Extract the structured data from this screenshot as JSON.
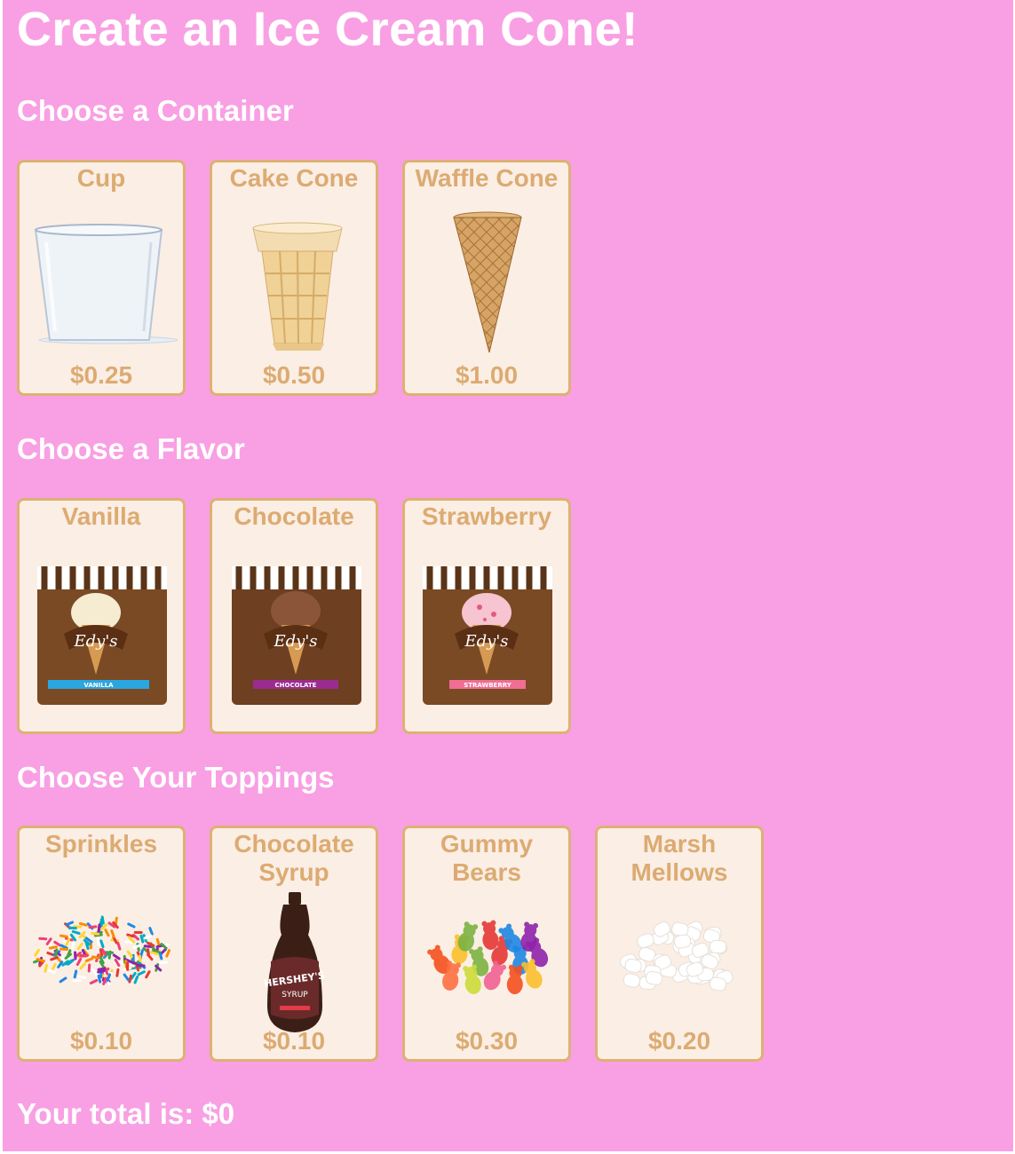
{
  "page": {
    "title": "Create an Ice Cream Cone!",
    "total_label": "Your total is: $0"
  },
  "containers": {
    "heading": "Choose a Container",
    "items": [
      {
        "label": "Cup",
        "price": "$0.25",
        "image": "plastic-cup-image"
      },
      {
        "label": "Cake Cone",
        "price": "$0.50",
        "image": "cake-cone-image"
      },
      {
        "label": "Waffle Cone",
        "price": "$1.00",
        "image": "waffle-cone-image"
      }
    ]
  },
  "flavors": {
    "heading": "Choose a Flavor",
    "items": [
      {
        "label": "Vanilla",
        "image": "vanilla-carton-image",
        "brand": "Edy's",
        "band": "VANILLA",
        "band_color": "#2aa6e0",
        "scoop_color": "#f6ecd2"
      },
      {
        "label": "Chocolate",
        "image": "chocolate-carton-image",
        "brand": "Edy's",
        "band": "CHOCOLATE",
        "band_color": "#9b2c8f",
        "scoop_color": "#8a5538"
      },
      {
        "label": "Strawberry",
        "image": "strawberry-carton-image",
        "brand": "Edy's",
        "band": "STRAWBERRY",
        "band_color": "#f06d94",
        "scoop_color": "#f7c4d1"
      }
    ]
  },
  "toppings": {
    "heading": "Choose Your Toppings",
    "items": [
      {
        "label": "Sprinkles",
        "price": "$0.10",
        "image": "sprinkles-image"
      },
      {
        "label": "Chocolate Syrup",
        "price": "$0.10",
        "image": "chocolate-syrup-bottle-image",
        "brand": "HERSHEY'S",
        "sub": "SYRUP"
      },
      {
        "label": "Gummy Bears",
        "price": "$0.30",
        "image": "gummy-bears-image"
      },
      {
        "label": "Marsh Mellows",
        "price": "$0.20",
        "image": "marshmallows-image"
      }
    ]
  },
  "colors": {
    "background": "#f8a0e3",
    "card": "#fbeee4",
    "card_border": "#ddb174",
    "card_text": "#dcab72",
    "heading_text": "#ffffff"
  }
}
